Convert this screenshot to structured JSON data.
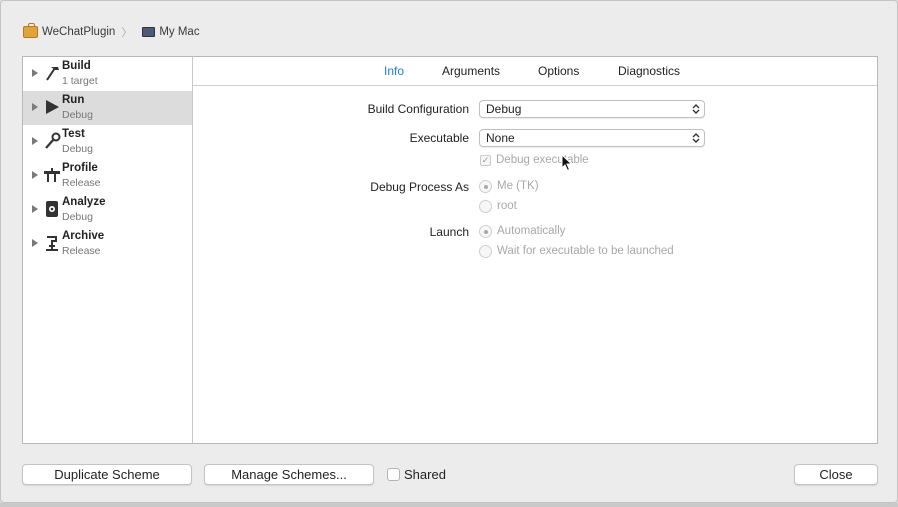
{
  "breadcrumb": {
    "project": "WeChatPlugin",
    "destination": "My Mac"
  },
  "sidebar": {
    "items": [
      {
        "name": "Build",
        "sub": "1 target",
        "icon": "hammer-icon"
      },
      {
        "name": "Run",
        "sub": "Debug",
        "icon": "play-icon",
        "selected": true
      },
      {
        "name": "Test",
        "sub": "Debug",
        "icon": "wrench-icon"
      },
      {
        "name": "Profile",
        "sub": "Release",
        "icon": "instruments-icon"
      },
      {
        "name": "Analyze",
        "sub": "Debug",
        "icon": "analyze-icon"
      },
      {
        "name": "Archive",
        "sub": "Release",
        "icon": "archive-icon"
      }
    ]
  },
  "tabs": [
    {
      "label": "Info",
      "active": true
    },
    {
      "label": "Arguments"
    },
    {
      "label": "Options"
    },
    {
      "label": "Diagnostics"
    }
  ],
  "form": {
    "build_configuration_label": "Build Configuration",
    "build_configuration_value": "Debug",
    "executable_label": "Executable",
    "executable_value": "None",
    "debug_executable_label": "Debug executable",
    "debug_process_as_label": "Debug Process As",
    "process_me": "Me (TK)",
    "process_root": "root",
    "launch_label": "Launch",
    "launch_auto": "Automatically",
    "launch_wait": "Wait for executable to be launched"
  },
  "footer": {
    "duplicate_label": "Duplicate Scheme",
    "manage_label": "Manage Schemes...",
    "shared_label": "Shared",
    "close_label": "Close"
  },
  "colors": {
    "accent": "#1a7ed8",
    "selected_row": "#dcdcdc"
  }
}
